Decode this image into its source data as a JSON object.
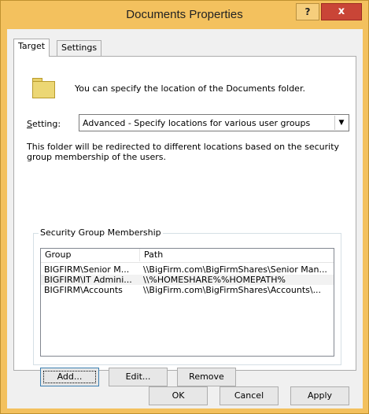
{
  "window": {
    "title": "Documents Properties",
    "help_label": "?",
    "close_label": "x"
  },
  "tabs": [
    {
      "label": "Target",
      "active": true
    },
    {
      "label": "Settings",
      "active": false
    }
  ],
  "target": {
    "description": "You can specify the location of the Documents folder.",
    "setting_label_prefix": "S",
    "setting_label_rest": "etting:",
    "setting_value": "Advanced - Specify locations for various user groups",
    "info_text": "This folder will be redirected to different locations based on the security group membership of the users."
  },
  "group_box": {
    "legend": "Security Group Membership",
    "columns": [
      "Group",
      "Path"
    ],
    "rows": [
      {
        "group": "BIGFIRM\\Senior M...",
        "path": "\\\\BigFirm.com\\BigFirmShares\\Senior Man...",
        "selected": false
      },
      {
        "group": "BIGFIRM\\IT Admini...",
        "path": "\\\\%HOMESHARE%%HOMEPATH%",
        "selected": true
      },
      {
        "group": "BIGFIRM\\Accounts",
        "path": "\\\\BigFirm.com\\BigFirmShares\\Accounts\\...",
        "selected": false
      }
    ],
    "add_label": "Add...",
    "edit_label": "Edit...",
    "remove_label": "Remove"
  },
  "footer": {
    "ok_label": "OK",
    "cancel_label": "Cancel",
    "apply_label": "Apply"
  },
  "colors": {
    "title_bar": "#f3c15e",
    "close_button": "#c94537"
  }
}
